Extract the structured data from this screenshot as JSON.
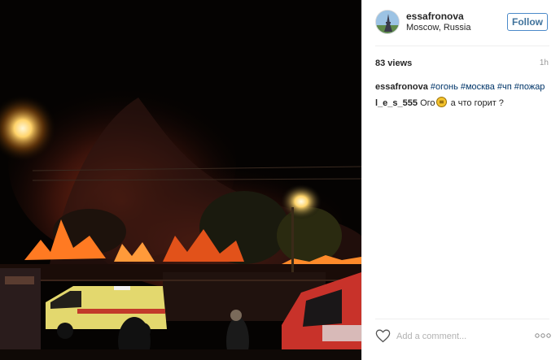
{
  "header": {
    "username": "essafronova",
    "location": "Moscow, Russia",
    "follow_label": "Follow"
  },
  "stats": {
    "views": "83 views",
    "time": "1h"
  },
  "caption": {
    "user": "essafronova",
    "tags": [
      "#огонь",
      "#москва",
      "#чп",
      "#пожар"
    ]
  },
  "comments": [
    {
      "user": "l_e_s_555",
      "text_before_emoji": "Ого",
      "text_after_emoji": " а что горит ?"
    }
  ],
  "comment_input": {
    "placeholder": "Add a comment..."
  },
  "icons": {
    "heart": "heart-icon",
    "more": "more-options-icon",
    "avatar": "avatar"
  },
  "colors": {
    "follow_border": "#4b8ac9",
    "follow_text": "#3f729b",
    "hashtag": "#003569",
    "fire_orange": "#ff6a1a"
  }
}
